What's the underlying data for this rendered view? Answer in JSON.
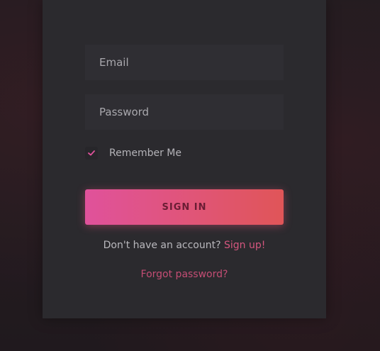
{
  "form": {
    "email_placeholder": "Email",
    "email_value": "",
    "password_placeholder": "Password",
    "password_value": "",
    "remember_label": "Remember Me",
    "remember_checked": true,
    "signin_label": "SIGN IN",
    "signup_prompt": "Don't have an account?",
    "signup_link": "Sign up!",
    "forgot_link": "Forgot password?"
  },
  "colors": {
    "accent": "#e0529b",
    "accent_end": "#e05558",
    "link": "#d4567e",
    "card_background": "#2b2a2e",
    "input_background": "#2f2e33"
  },
  "icons": {
    "checkbox": "checkmark-icon"
  }
}
